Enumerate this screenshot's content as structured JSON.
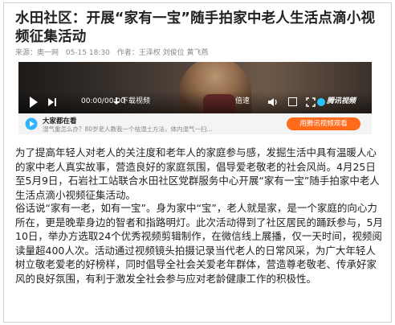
{
  "article": {
    "title": "水田社区：开展“家有一宝”随手拍家中老人生活点滴小视频征集活动",
    "meta": {
      "source": "来源：奥一网",
      "date": "05-15 18:30",
      "author": "作者：王泽权 刘俊位 黄飞燕"
    },
    "paragraphs": [
      "为了提高年轻人对老人的关注度和老年人的家庭参与感，发掘生活中具有温暖人心的家中老人真实故事，营造良好的家庭氛围，倡导爱老敬老的社会风尚。4月25日至5月9日，石岩社工站联合水田社区党群服务中心开展“家有一宝”随手拍家中老人生活点滴小视频征集活动。",
      "俗话说“家有一老，如有一宝”。身为家中“宝”，老人就是家，是一个家庭的向心力所在，更是晚辈身边的智者和指路明灯。此次活动得到了社区居民的踊跃参与，5月10日，举办方选取24个优秀视频剪辑制作，在微信线上展播，仅一天时间，视频阅读量超400人次。活动通过视频镜头拍摄记录当代老人的日常风采，为广大年轻人树立敬老爱老的好榜样，同时倡导全社会关爱老年群体，营造尊老敬老、传承好家风的良好氛围，有利于激发全社会参与应对老龄健康工作的积极性。"
    ]
  },
  "video": {
    "time": "00:00/00:00",
    "download_label": "下载视频",
    "speed_label": "倍速",
    "brand_label": "腾讯视频"
  },
  "promo": {
    "headline": "大家都在看",
    "subtext": "湿气重怎么办？80岁老人教我一个祛湿土方法，体内湿气一扫…",
    "button_label": "用腾讯视频观看",
    "accent_color": "#ff6a1b"
  }
}
